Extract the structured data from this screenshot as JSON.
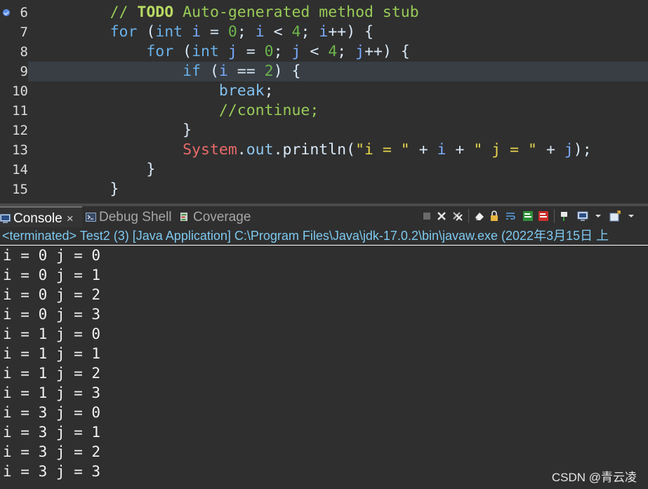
{
  "editor": {
    "lines": [
      {
        "number": "6",
        "has_marker": true,
        "current": false,
        "tokens": [
          [
            "t-pl",
            "        "
          ],
          [
            "t-cm",
            "// "
          ],
          [
            "t-todo",
            "TODO"
          ],
          [
            "t-cm",
            " Auto-generated method stub"
          ]
        ]
      },
      {
        "number": "7",
        "has_marker": false,
        "current": false,
        "tokens": [
          [
            "t-pl",
            "        "
          ],
          [
            "t-kw",
            "for"
          ],
          [
            "t-pl",
            " ("
          ],
          [
            "t-kw",
            "int"
          ],
          [
            "t-pl",
            " "
          ],
          [
            "t-var",
            "i"
          ],
          [
            "t-pl",
            " = "
          ],
          [
            "t-num",
            "0"
          ],
          [
            "t-pl",
            "; "
          ],
          [
            "t-var",
            "i"
          ],
          [
            "t-pl",
            " < "
          ],
          [
            "t-num",
            "4"
          ],
          [
            "t-pl",
            "; "
          ],
          [
            "t-var",
            "i"
          ],
          [
            "t-pl",
            "++) {"
          ]
        ]
      },
      {
        "number": "8",
        "has_marker": false,
        "current": false,
        "tokens": [
          [
            "t-pl",
            "            "
          ],
          [
            "t-kw",
            "for"
          ],
          [
            "t-pl",
            " ("
          ],
          [
            "t-kw",
            "int"
          ],
          [
            "t-pl",
            " "
          ],
          [
            "t-var",
            "j"
          ],
          [
            "t-pl",
            " = "
          ],
          [
            "t-num",
            "0"
          ],
          [
            "t-pl",
            "; "
          ],
          [
            "t-var",
            "j"
          ],
          [
            "t-pl",
            " < "
          ],
          [
            "t-num",
            "4"
          ],
          [
            "t-pl",
            "; "
          ],
          [
            "t-var",
            "j"
          ],
          [
            "t-pl",
            "++) {"
          ]
        ]
      },
      {
        "number": "9",
        "has_marker": false,
        "current": true,
        "tokens": [
          [
            "t-pl",
            "                "
          ],
          [
            "t-kw",
            "if"
          ],
          [
            "t-pl",
            " ("
          ],
          [
            "t-var",
            "i"
          ],
          [
            "t-pl",
            " == "
          ],
          [
            "t-num",
            "2"
          ],
          [
            "t-pl",
            ") {"
          ]
        ]
      },
      {
        "number": "10",
        "has_marker": false,
        "current": false,
        "tokens": [
          [
            "t-pl",
            "                    "
          ],
          [
            "t-brk",
            "break"
          ],
          [
            "t-pl",
            ";"
          ]
        ]
      },
      {
        "number": "11",
        "has_marker": false,
        "current": false,
        "tokens": [
          [
            "t-pl",
            "                    "
          ],
          [
            "t-cm",
            "//continue;"
          ]
        ]
      },
      {
        "number": "12",
        "has_marker": false,
        "current": false,
        "tokens": [
          [
            "t-pl",
            "                }"
          ]
        ]
      },
      {
        "number": "13",
        "has_marker": false,
        "current": false,
        "tokens": [
          [
            "t-pl",
            "                "
          ],
          [
            "t-sys",
            "System"
          ],
          [
            "t-pl",
            "."
          ],
          [
            "t-fld",
            "out"
          ],
          [
            "t-pl",
            ".println("
          ],
          [
            "t-str",
            "\"i = \""
          ],
          [
            "t-pl",
            " + "
          ],
          [
            "t-var",
            "i"
          ],
          [
            "t-pl",
            " + "
          ],
          [
            "t-str",
            "\" j = \""
          ],
          [
            "t-pl",
            " + "
          ],
          [
            "t-var",
            "j"
          ],
          [
            "t-pl",
            ");"
          ]
        ]
      },
      {
        "number": "14",
        "has_marker": false,
        "current": false,
        "tokens": [
          [
            "t-pl",
            "            }"
          ]
        ]
      },
      {
        "number": "15",
        "has_marker": false,
        "current": false,
        "tokens": [
          [
            "t-pl",
            "        }"
          ]
        ]
      }
    ]
  },
  "tabs": {
    "console": "Console",
    "close": "×",
    "debug_shell": "Debug Shell",
    "coverage": "Coverage"
  },
  "status": "<terminated> Test2 (3) [Java Application] C:\\Program Files\\Java\\jdk-17.0.2\\bin\\javaw.exe  (2022年3月15日 上",
  "output": [
    "i = 0 j = 0",
    "i = 0 j = 1",
    "i = 0 j = 2",
    "i = 0 j = 3",
    "i = 1 j = 0",
    "i = 1 j = 1",
    "i = 1 j = 2",
    "i = 1 j = 3",
    "i = 3 j = 0",
    "i = 3 j = 1",
    "i = 3 j = 2",
    "i = 3 j = 3"
  ],
  "watermark": "CSDN @青云凌"
}
